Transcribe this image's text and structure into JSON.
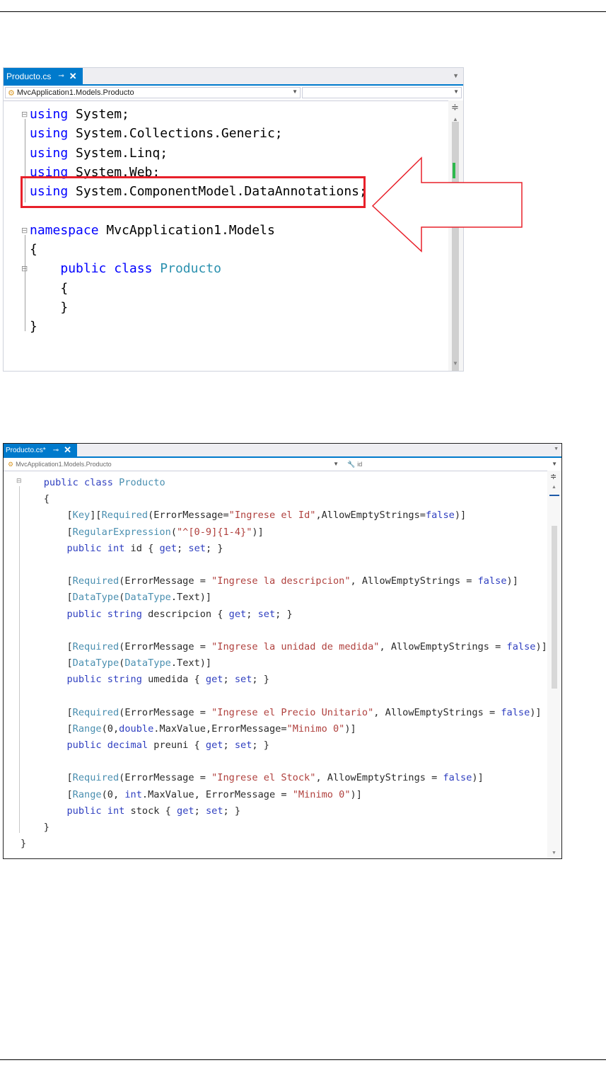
{
  "editor1": {
    "tab": {
      "label": "Producto.cs",
      "pin": "⊸",
      "close": "✕"
    },
    "nav": {
      "left": "MvcApplication1.Models.Producto",
      "right": ""
    },
    "lines": [
      [
        [
          "kw",
          "using"
        ],
        [
          "t",
          " System;"
        ]
      ],
      [
        [
          "kw",
          "using"
        ],
        [
          "t",
          " System.Collections.Generic;"
        ]
      ],
      [
        [
          "kw",
          "using"
        ],
        [
          "t",
          " System.Linq;"
        ]
      ],
      [
        [
          "kw",
          "using"
        ],
        [
          "t",
          " System.Web;"
        ]
      ],
      [
        [
          "kw",
          "using"
        ],
        [
          "t",
          " System.ComponentModel.DataAnnotations;"
        ]
      ],
      [
        [
          "t",
          ""
        ]
      ],
      [
        [
          "kw",
          "namespace"
        ],
        [
          "t",
          " MvcApplication1.Models"
        ]
      ],
      [
        [
          "t",
          "{"
        ]
      ],
      [
        [
          "t",
          "    "
        ],
        [
          "kw",
          "public"
        ],
        [
          "t",
          " "
        ],
        [
          "kw",
          "class"
        ],
        [
          "t",
          " "
        ],
        [
          "ty",
          "Producto"
        ]
      ],
      [
        [
          "t",
          "    {"
        ]
      ],
      [
        [
          "t",
          "    }"
        ]
      ],
      [
        [
          "t",
          "}"
        ]
      ]
    ],
    "highlight_line": 5
  },
  "editor2": {
    "tab": {
      "label": "Producto.cs*",
      "pin": "⊸",
      "close": "✕"
    },
    "nav": {
      "left": "MvcApplication1.Models.Producto",
      "right": "id"
    },
    "lines": [
      [
        [
          "t",
          "    "
        ],
        [
          "kw",
          "public"
        ],
        [
          "t",
          " "
        ],
        [
          "kw",
          "class"
        ],
        [
          "t",
          " "
        ],
        [
          "ty",
          "Producto"
        ]
      ],
      [
        [
          "t",
          "    {"
        ]
      ],
      [
        [
          "t",
          "        ["
        ],
        [
          "ty",
          "Key"
        ],
        [
          "t",
          "]["
        ],
        [
          "ty",
          "Required"
        ],
        [
          "t",
          "(ErrorMessage="
        ],
        [
          "str",
          "\"Ingrese el Id\""
        ],
        [
          "t",
          ",AllowEmptyStrings="
        ],
        [
          "kw",
          "false"
        ],
        [
          "t",
          ")]"
        ]
      ],
      [
        [
          "t",
          "        ["
        ],
        [
          "ty",
          "RegularExpression"
        ],
        [
          "t",
          "("
        ],
        [
          "str",
          "\"^[0-9]{1-4}\""
        ],
        [
          "t",
          ")]"
        ]
      ],
      [
        [
          "t",
          "        "
        ],
        [
          "kw",
          "public"
        ],
        [
          "t",
          " "
        ],
        [
          "kw",
          "int"
        ],
        [
          "t",
          " id { "
        ],
        [
          "kw",
          "get"
        ],
        [
          "t",
          "; "
        ],
        [
          "kw",
          "set"
        ],
        [
          "t",
          "; }"
        ]
      ],
      [
        [
          "t",
          ""
        ]
      ],
      [
        [
          "t",
          "        ["
        ],
        [
          "ty",
          "Required"
        ],
        [
          "t",
          "(ErrorMessage = "
        ],
        [
          "str",
          "\"Ingrese la descripcion\""
        ],
        [
          "t",
          ", AllowEmptyStrings = "
        ],
        [
          "kw",
          "false"
        ],
        [
          "t",
          ")]"
        ]
      ],
      [
        [
          "t",
          "        ["
        ],
        [
          "ty",
          "DataType"
        ],
        [
          "t",
          "("
        ],
        [
          "ty",
          "DataType"
        ],
        [
          "t",
          ".Text)]"
        ]
      ],
      [
        [
          "t",
          "        "
        ],
        [
          "kw",
          "public"
        ],
        [
          "t",
          " "
        ],
        [
          "kw",
          "string"
        ],
        [
          "t",
          " descripcion { "
        ],
        [
          "kw",
          "get"
        ],
        [
          "t",
          "; "
        ],
        [
          "kw",
          "set"
        ],
        [
          "t",
          "; }"
        ]
      ],
      [
        [
          "t",
          ""
        ]
      ],
      [
        [
          "t",
          "        ["
        ],
        [
          "ty",
          "Required"
        ],
        [
          "t",
          "(ErrorMessage = "
        ],
        [
          "str",
          "\"Ingrese la unidad de medida\""
        ],
        [
          "t",
          ", AllowEmptyStrings = "
        ],
        [
          "kw",
          "false"
        ],
        [
          "t",
          ")]"
        ]
      ],
      [
        [
          "t",
          "        ["
        ],
        [
          "ty",
          "DataType"
        ],
        [
          "t",
          "("
        ],
        [
          "ty",
          "DataType"
        ],
        [
          "t",
          ".Text)]"
        ]
      ],
      [
        [
          "t",
          "        "
        ],
        [
          "kw",
          "public"
        ],
        [
          "t",
          " "
        ],
        [
          "kw",
          "string"
        ],
        [
          "t",
          " umedida { "
        ],
        [
          "kw",
          "get"
        ],
        [
          "t",
          "; "
        ],
        [
          "kw",
          "set"
        ],
        [
          "t",
          "; }"
        ]
      ],
      [
        [
          "t",
          ""
        ]
      ],
      [
        [
          "t",
          "        ["
        ],
        [
          "ty",
          "Required"
        ],
        [
          "t",
          "(ErrorMessage = "
        ],
        [
          "str",
          "\"Ingrese el Precio Unitario\""
        ],
        [
          "t",
          ", AllowEmptyStrings = "
        ],
        [
          "kw",
          "false"
        ],
        [
          "t",
          ")]"
        ]
      ],
      [
        [
          "t",
          "        ["
        ],
        [
          "ty",
          "Range"
        ],
        [
          "t",
          "(0,"
        ],
        [
          "kw",
          "double"
        ],
        [
          "t",
          ".MaxValue,ErrorMessage="
        ],
        [
          "str",
          "\"Minimo 0\""
        ],
        [
          "t",
          ")]"
        ]
      ],
      [
        [
          "t",
          "        "
        ],
        [
          "kw",
          "public"
        ],
        [
          "t",
          " "
        ],
        [
          "kw",
          "decimal"
        ],
        [
          "t",
          " preuni { "
        ],
        [
          "kw",
          "get"
        ],
        [
          "t",
          "; "
        ],
        [
          "kw",
          "set"
        ],
        [
          "t",
          "; }"
        ]
      ],
      [
        [
          "t",
          ""
        ]
      ],
      [
        [
          "t",
          "        ["
        ],
        [
          "ty",
          "Required"
        ],
        [
          "t",
          "(ErrorMessage = "
        ],
        [
          "str",
          "\"Ingrese el Stock\""
        ],
        [
          "t",
          ", AllowEmptyStrings = "
        ],
        [
          "kw",
          "false"
        ],
        [
          "t",
          ")]"
        ]
      ],
      [
        [
          "t",
          "        ["
        ],
        [
          "ty",
          "Range"
        ],
        [
          "t",
          "(0, "
        ],
        [
          "kw",
          "int"
        ],
        [
          "t",
          ".MaxValue, ErrorMessage = "
        ],
        [
          "str",
          "\"Minimo 0\""
        ],
        [
          "t",
          ")]"
        ]
      ],
      [
        [
          "t",
          "        "
        ],
        [
          "kw",
          "public"
        ],
        [
          "t",
          " "
        ],
        [
          "kw",
          "int"
        ],
        [
          "t",
          " stock { "
        ],
        [
          "kw",
          "get"
        ],
        [
          "t",
          "; "
        ],
        [
          "kw",
          "set"
        ],
        [
          "t",
          "; }"
        ]
      ],
      [
        [
          "t",
          "    }"
        ]
      ],
      [
        [
          "t",
          "}"
        ]
      ]
    ]
  },
  "colors": {
    "tab_active": "#007acc",
    "keyword": "#0000ff",
    "type": "#2b91af",
    "string": "#a31515",
    "highlight_border": "#e8202a"
  },
  "icons": {
    "class_icon": "class-icon",
    "split": "split-icon",
    "scroll_up": "scroll-up-icon",
    "scroll_down": "scroll-down-icon",
    "arrow": "red-arrow-icon"
  }
}
